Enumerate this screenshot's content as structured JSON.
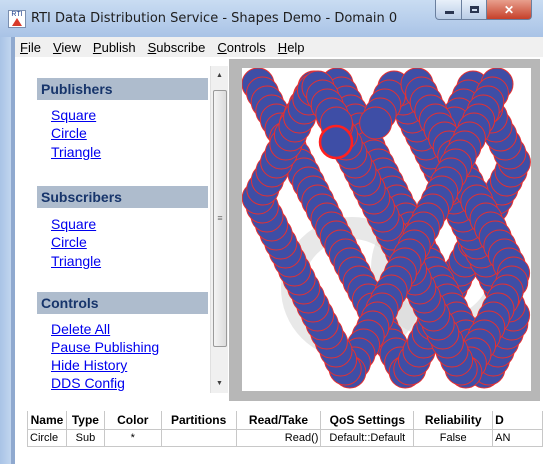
{
  "window": {
    "title": "RTI Data Distribution Service - Shapes Demo - Domain 0",
    "icon_name": "rti-app-icon",
    "icon_text": "RTI"
  },
  "menu": [
    {
      "label": "File",
      "accel": "F",
      "rest": "ile"
    },
    {
      "label": "View",
      "accel": "V",
      "rest": "iew"
    },
    {
      "label": "Publish",
      "accel": "P",
      "rest": "ublish"
    },
    {
      "label": "Subscribe",
      "accel": "S",
      "rest": "ubscribe"
    },
    {
      "label": "Controls",
      "accel": "C",
      "rest": "ontrols"
    },
    {
      "label": "Help",
      "accel": "H",
      "rest": "elp"
    }
  ],
  "sidebar": {
    "publishers": {
      "title": "Publishers",
      "items": [
        "Square",
        "Circle",
        "Triangle"
      ]
    },
    "subscribers": {
      "title": "Subscribers",
      "items": [
        "Square",
        "Circle",
        "Triangle"
      ]
    },
    "controls": {
      "title": "Controls",
      "items": [
        "Delete All",
        "Pause Publishing",
        "Hide History",
        "DDS Config"
      ]
    }
  },
  "canvas": {
    "shape": "circle",
    "fill_color": "#3e4ea6",
    "outline_color": "#e83030",
    "highlight_outline": "#ff2020",
    "frame_color": "#b7b7b7",
    "watermark_color": "#d9d9d9"
  },
  "table": {
    "columns": [
      "Name",
      "Type",
      "Color",
      "Partitions",
      "Read/Take",
      "QoS Settings",
      "Reliability",
      "D"
    ],
    "rows": [
      [
        "Circle",
        "Sub",
        "*",
        "",
        "Read()",
        "Default::Default",
        "False",
        "AN"
      ]
    ]
  },
  "colors": {
    "title_bar": "#b9d0ee",
    "section_header_bg": "#aebccd",
    "section_header_text": "#17356b",
    "link": "#0000ee",
    "close_button": "#c6402a"
  }
}
